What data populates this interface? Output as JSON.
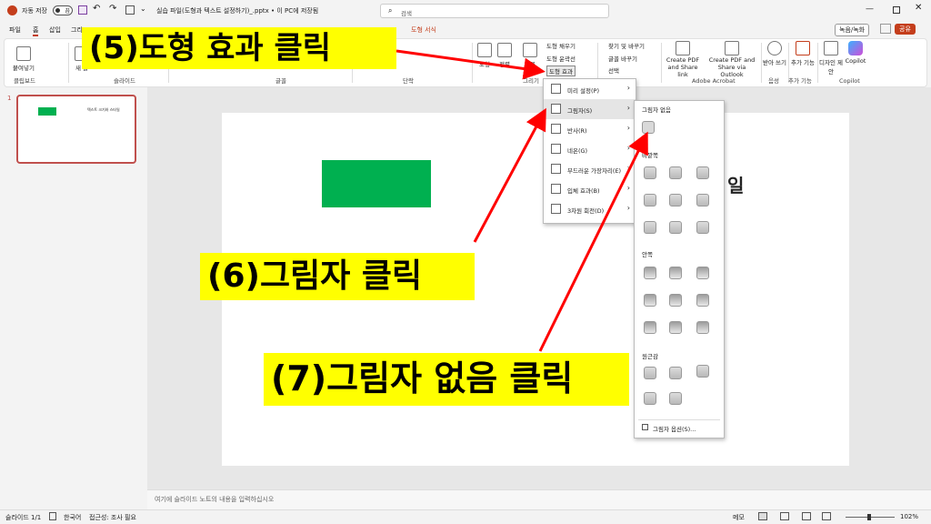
{
  "titlebar": {
    "autosave": "자동 저장",
    "toggle": "끔",
    "filename": "실습 파일(도형과 텍스트 설정하기)_.pptx • 이 PC에 저장됨",
    "search_placeholder": "검색"
  },
  "tabs": [
    "파일",
    "홈",
    "삽입",
    "그리",
    "도형 서식"
  ],
  "ribbon": {
    "clipboard": {
      "paste": "붙여넣기",
      "group": "클립보드"
    },
    "slides": {
      "new": "새 슬",
      "group": "슬라이드"
    },
    "font": {
      "group": "글꼴"
    },
    "paragraph": {
      "group": "단락"
    },
    "drawing": {
      "fill": "도형 채우기",
      "outline": "도형 윤곽선",
      "effects": "도형 효과",
      "group": "그리기",
      "shape_label": "빠른",
      "s1": "도형",
      "s2": "정렬"
    },
    "editing": {
      "find": "찾기 및 바꾸기",
      "replace": "글꼴 바꾸기",
      "select": "선택"
    },
    "acrobat": {
      "b1": "Create PDF and Share link",
      "b2": "Create PDF and Share via Outlook",
      "group": "Adobe Acrobat"
    },
    "voice": {
      "dictate": "받아 쓰기",
      "group": "음성"
    },
    "addins": {
      "label": "추가 기능",
      "group": "추가 기능"
    },
    "designer": {
      "label": "디자인 제안"
    },
    "copilot": {
      "label": "Copilot",
      "group": "Copilot"
    },
    "record": "녹음/녹화",
    "share": "공유"
  },
  "thumbnail": {
    "num": "1",
    "title": "텍스트 크기와 스타일"
  },
  "slide_partial_text": "일",
  "menu": {
    "items": [
      {
        "label": "미리 설정(P)"
      },
      {
        "label": "그림자(S)"
      },
      {
        "label": "반사(R)"
      },
      {
        "label": "네온(G)"
      },
      {
        "label": "부드러운 가장자리(E)"
      },
      {
        "label": "입체 효과(B)"
      },
      {
        "label": "3차원 회전(D)"
      }
    ]
  },
  "shadow_submenu": {
    "none": "그림자 없음",
    "outer": "바깥쪽",
    "inner": "안쪽",
    "perspective": "원근감",
    "options": "그림자 옵션(S)..."
  },
  "notes_placeholder": "여기에 슬라이드 노트의 내용을 입력하십시오",
  "status": {
    "slide": "슬라이드 1/1",
    "lang": "한국어",
    "access": "접근성: 조사 필요",
    "notes": "메모",
    "zoom": "102%"
  },
  "annotations": {
    "step5": "(5)도형 효과 클릭",
    "step6": "(6)그림자 클릭",
    "step7": "(7)그림자 없음 클릭"
  },
  "colors": {
    "banner": "#ffff00",
    "arrow": "#ff0000",
    "shape": "#00b050",
    "accent": "#c43e1c"
  }
}
